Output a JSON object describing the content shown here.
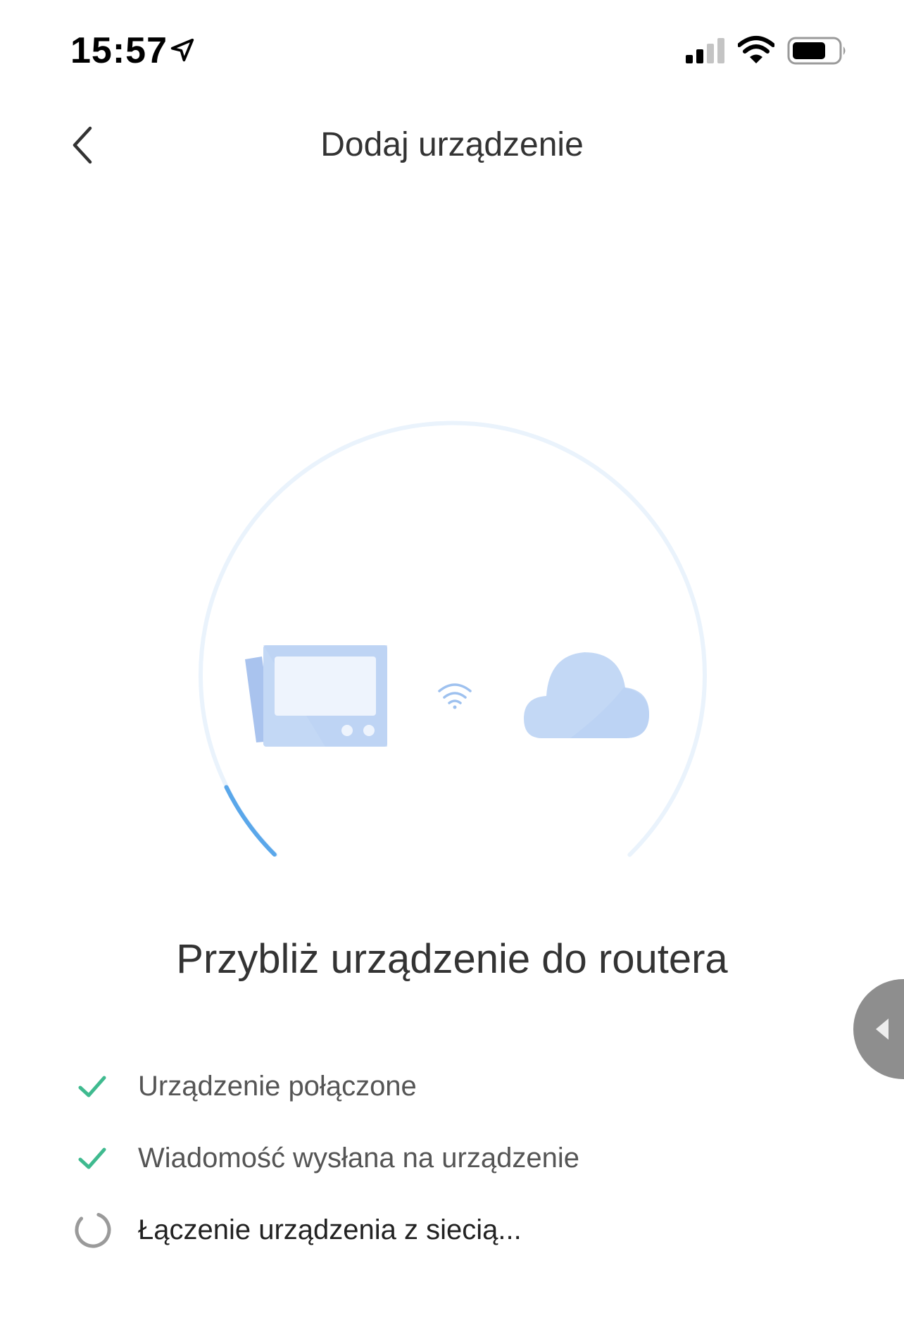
{
  "status_bar": {
    "time": "15:57",
    "icons": [
      "location-arrow-icon",
      "cellular-signal-icon",
      "wifi-icon",
      "battery-icon"
    ]
  },
  "nav": {
    "back_icon": "chevron-left-icon",
    "title": "Dodaj urządzenie"
  },
  "illustration": {
    "icons": [
      "device-icon",
      "wifi-signal-icon",
      "cloud-icon"
    ],
    "progress": 0.07
  },
  "main": {
    "message": "Przybliż urządzenie do routera"
  },
  "steps": [
    {
      "label": "Urządzenie połączone",
      "status": "done",
      "icon": "check-icon"
    },
    {
      "label": "Wiadomość wysłana na urządzenie",
      "status": "done",
      "icon": "check-icon"
    },
    {
      "label": "Łączenie urządzenia z siecią...",
      "status": "in-progress",
      "icon": "loading-spinner-icon"
    }
  ],
  "side_handle": {
    "icon": "triangle-left-icon"
  },
  "colors": {
    "check": "#3fba8f",
    "progress_arc": "#5aa7ea",
    "track_arc": "#eaf3fc",
    "illustration_fill": "#c3d8f5",
    "illustration_dark": "#a9c3ee",
    "spinner": "#9a9a9a",
    "side_handle": "#8e8e8e"
  }
}
